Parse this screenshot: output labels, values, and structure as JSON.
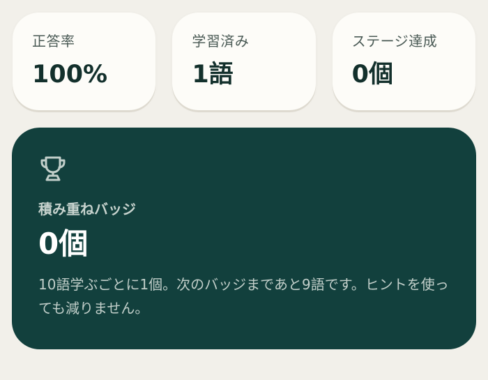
{
  "stats": [
    {
      "label": "正答率",
      "value": "100%"
    },
    {
      "label": "学習済み",
      "value": "1語"
    },
    {
      "label": "ステージ達成",
      "value": "0個"
    }
  ],
  "badge_panel": {
    "icon": "trophy-icon",
    "title": "積み重ねバッジ",
    "count": "0個",
    "description": "10語学ぶごとに1個。次のバッジまであと9語です。ヒントを使っても減りません。"
  },
  "colors": {
    "page_background": "#f2f0ea",
    "card_background": "#fdfcf8",
    "panel_background": "#12403d",
    "text_dark": "#13302c"
  }
}
